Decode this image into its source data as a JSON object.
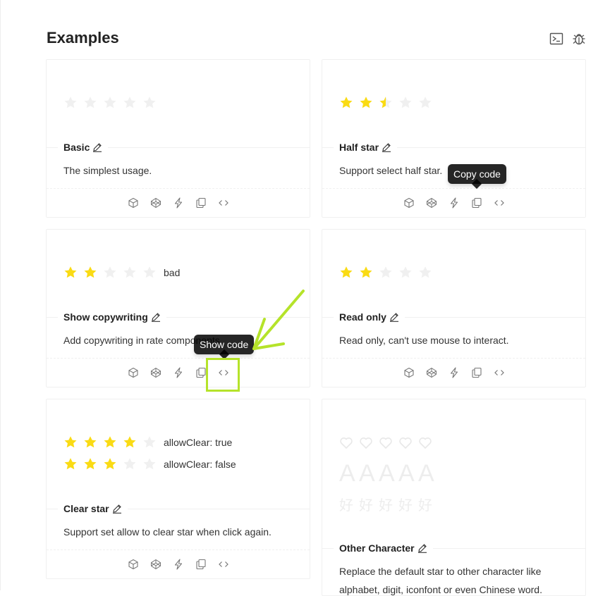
{
  "page": {
    "title": "Examples"
  },
  "colors": {
    "star_active": "#fadb14",
    "star_inactive": "#f0f0f0",
    "highlight": "#b5e32a",
    "tooltip_bg": "#262626"
  },
  "toolbar_icons": [
    "terminal-icon",
    "bug-icon"
  ],
  "action_icons": [
    "codesandbox-icon",
    "codepen-icon",
    "stackblitz-icon",
    "copy-icon",
    "code-icon"
  ],
  "cards": {
    "basic": {
      "title": "Basic",
      "description": "The simplest usage.",
      "rating": 0,
      "count": 5
    },
    "half": {
      "title": "Half star",
      "description": "Support select half star.",
      "rating": 2.5,
      "count": 5
    },
    "copywriting": {
      "title": "Show copywriting",
      "description": "Add copywriting in rate components.",
      "rating": 2,
      "count": 5,
      "label": "bad"
    },
    "readonly": {
      "title": "Read only",
      "description": "Read only, can't use mouse to interact.",
      "rating": 2,
      "count": 5
    },
    "clear": {
      "title": "Clear star",
      "description": "Support set allow to clear star when click again.",
      "rows": [
        {
          "rating": 4,
          "label": "allowClear: true"
        },
        {
          "rating": 3,
          "label": "allowClear: false"
        }
      ]
    },
    "other": {
      "title": "Other Character",
      "description": "Replace the default star to other character like",
      "description2": "alphabet, digit, iconfont or even Chinese word.",
      "heart_count": 5,
      "letters": [
        "A",
        "A",
        "A",
        "A",
        "A"
      ],
      "chinese": [
        "好",
        "好",
        "好",
        "好",
        "好"
      ]
    }
  },
  "tooltips": {
    "copy": "Copy code",
    "show": "Show code"
  }
}
